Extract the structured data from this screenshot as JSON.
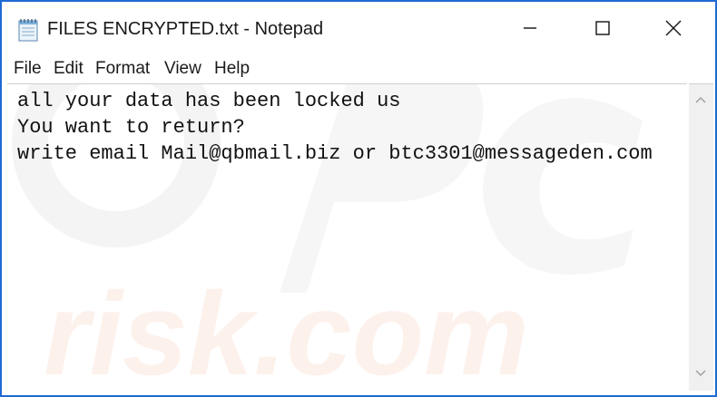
{
  "window": {
    "title": "FILES ENCRYPTED.txt - Notepad",
    "app_icon": "notepad-icon",
    "controls": [
      "minimize-icon",
      "maximize-icon",
      "close-icon"
    ],
    "accent_color": "#1e6ad2"
  },
  "menu": {
    "file": "File",
    "edit": "Edit",
    "format": "Format",
    "view": "View",
    "help": "Help"
  },
  "document": {
    "lines": [
      "all your data has been locked us",
      "You want to return?",
      "write email Mail@qbmail.biz or btc3301@messageden.com"
    ]
  },
  "watermark": {
    "text": "risk.com"
  },
  "scrollbar": {
    "icons": [
      "scroll-up-arrow-icon",
      "scroll-down-arrow-icon"
    ]
  }
}
